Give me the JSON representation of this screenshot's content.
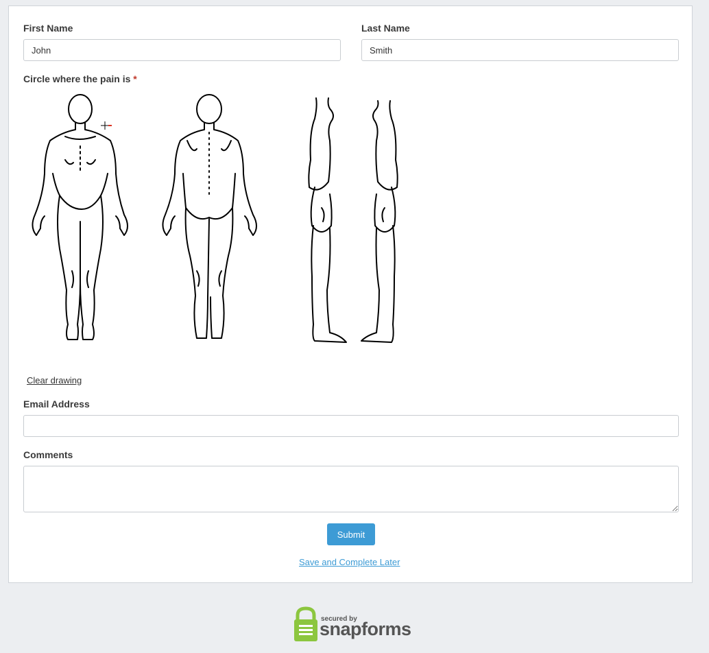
{
  "form": {
    "first_name": {
      "label": "First Name",
      "value": "John"
    },
    "last_name": {
      "label": "Last Name",
      "value": "Smith"
    },
    "pain_drawing": {
      "label": "Circle where the pain is",
      "required_mark": "*",
      "clear_label": "Clear drawing"
    },
    "email": {
      "label": "Email Address",
      "value": ""
    },
    "comments": {
      "label": "Comments",
      "value": ""
    },
    "submit_label": "Submit",
    "save_later_label": "Save and Complete Later"
  },
  "footer": {
    "secured_by": "secured by",
    "brand": "snapforms",
    "icon": "padlock-icon",
    "accent": "#8cc63f"
  },
  "colors": {
    "link": "#3d9bd5",
    "submit_bg": "#3d9bd5",
    "required": "#c0392b"
  }
}
